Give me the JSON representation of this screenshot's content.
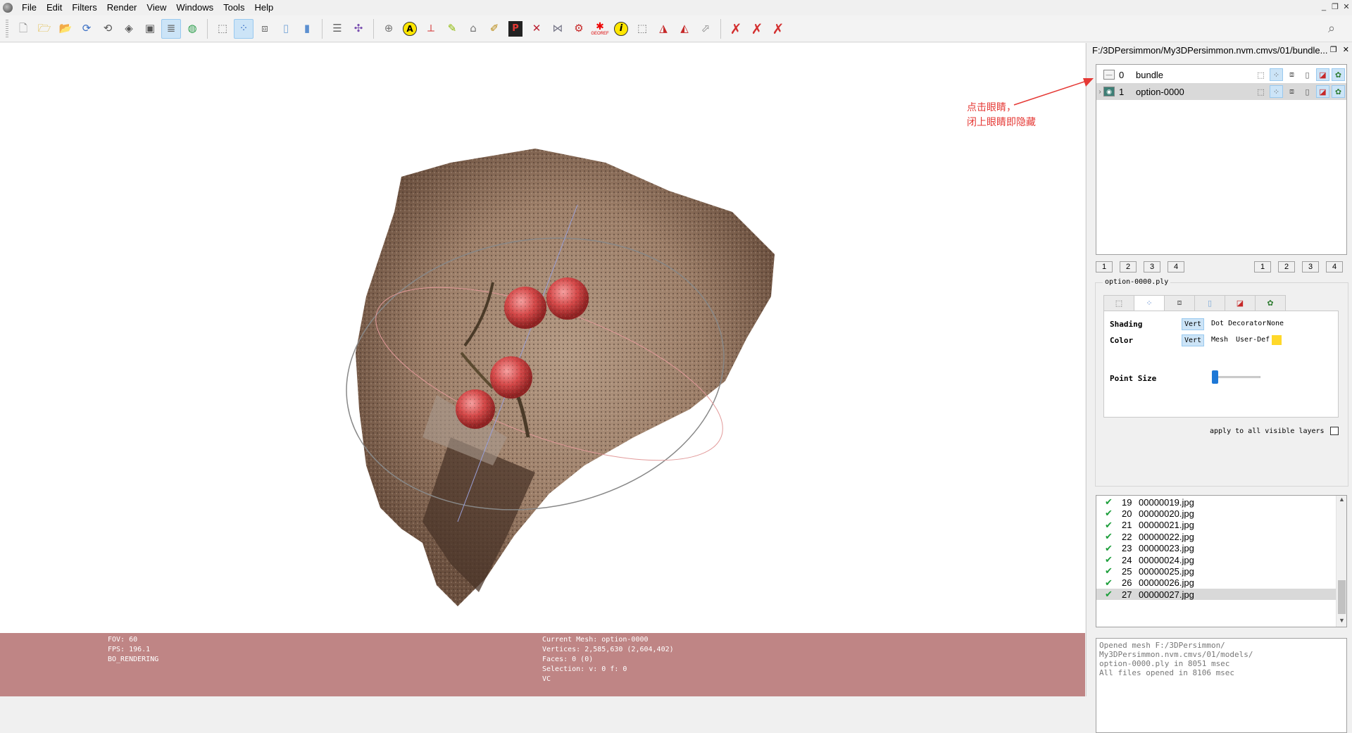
{
  "menu": [
    "File",
    "Edit",
    "Filters",
    "Render",
    "View",
    "Windows",
    "Tools",
    "Help"
  ],
  "window_controls": [
    "_",
    "❐",
    "✕"
  ],
  "toolbar_icons": [
    "new-project-icon",
    "open-project-icon",
    "import-mesh-icon",
    "reload-icon",
    "reload-all-icon",
    "export-mesh-icon",
    "snapshot-icon",
    "layers-icon",
    "shader-icon",
    "bbox-icon",
    "points-icon",
    "wireframe-icon",
    "flat-shading-icon",
    "smooth-shading-icon",
    "stack-icon",
    "manipulator-icon",
    "trackball-icon",
    "annotation-icon",
    "align-icon",
    "paint-icon",
    "brush-icon",
    "pdf-icon",
    "select-vertices-icon",
    "select-faces-icon",
    "measure-icon",
    "georef-icon",
    "info-icon",
    "select-connected-icon",
    "delete-faces-icon",
    "delete-vertices-icon",
    "delete-selection-icon",
    "delete-face-vert-icon",
    "delete-all-icon"
  ],
  "toolbar_active": [
    "layers-icon",
    "points-icon"
  ],
  "toolbar_georef_label": "GEOREF",
  "infobar": {
    "fov": "FOV: 60",
    "fps": "FPS:   196.1",
    "mode": "BO_RENDERING",
    "current_mesh": "Current Mesh: option-0000",
    "vertices": "Vertices: 2,585,630    (2,604,402)",
    "faces": "Faces: 0    (0)",
    "selection": "Selection: v: 0 f: 0",
    "vc": "VC"
  },
  "dock": {
    "title": "F:/3DPersimmon/My3DPersimmon.nvm.cmvs/01/bundle...",
    "layers": [
      {
        "num": "0",
        "name": "bundle",
        "visible": false
      },
      {
        "num": "1",
        "name": "option-0000",
        "visible": true,
        "selected": true
      }
    ],
    "annotation_line1": "点击眼睛，",
    "annotation_line2": "闭上眼睛即隐藏",
    "num_buttons_left": [
      "1",
      "2",
      "3",
      "4"
    ],
    "num_buttons_right": [
      "1",
      "2",
      "3",
      "4"
    ],
    "file_label": "option-0000.ply",
    "shading_label": "Shading",
    "shading_options": [
      "Vert",
      "Dot Decorator",
      "None"
    ],
    "color_label": "Color",
    "color_options": [
      "Vert",
      "Mesh",
      "User-Def"
    ],
    "user_def_color": "#ffd829",
    "point_size_label": "Point Size",
    "point_size": 0.05,
    "apply_all": "apply to all visible layers",
    "raster_rows": [
      {
        "num": "19",
        "file": "00000019.jpg"
      },
      {
        "num": "20",
        "file": "00000020.jpg"
      },
      {
        "num": "21",
        "file": "00000021.jpg"
      },
      {
        "num": "22",
        "file": "00000022.jpg"
      },
      {
        "num": "23",
        "file": "00000023.jpg"
      },
      {
        "num": "24",
        "file": "00000024.jpg"
      },
      {
        "num": "25",
        "file": "00000025.jpg"
      },
      {
        "num": "26",
        "file": "00000026.jpg"
      },
      {
        "num": "27",
        "file": "00000027.jpg"
      }
    ],
    "log_lines": [
      "Opened mesh F:/3DPersimmon/",
      "My3DPersimmon.nvm.cmvs/01/models/",
      "option-0000.ply in 8051 msec",
      "All files opened in 8106 msec"
    ]
  },
  "colors": {
    "infobar_bg": "#bf8585",
    "accent": "#cce4f7",
    "annotation": "#e53935",
    "eye_open": "#3d7f76"
  }
}
